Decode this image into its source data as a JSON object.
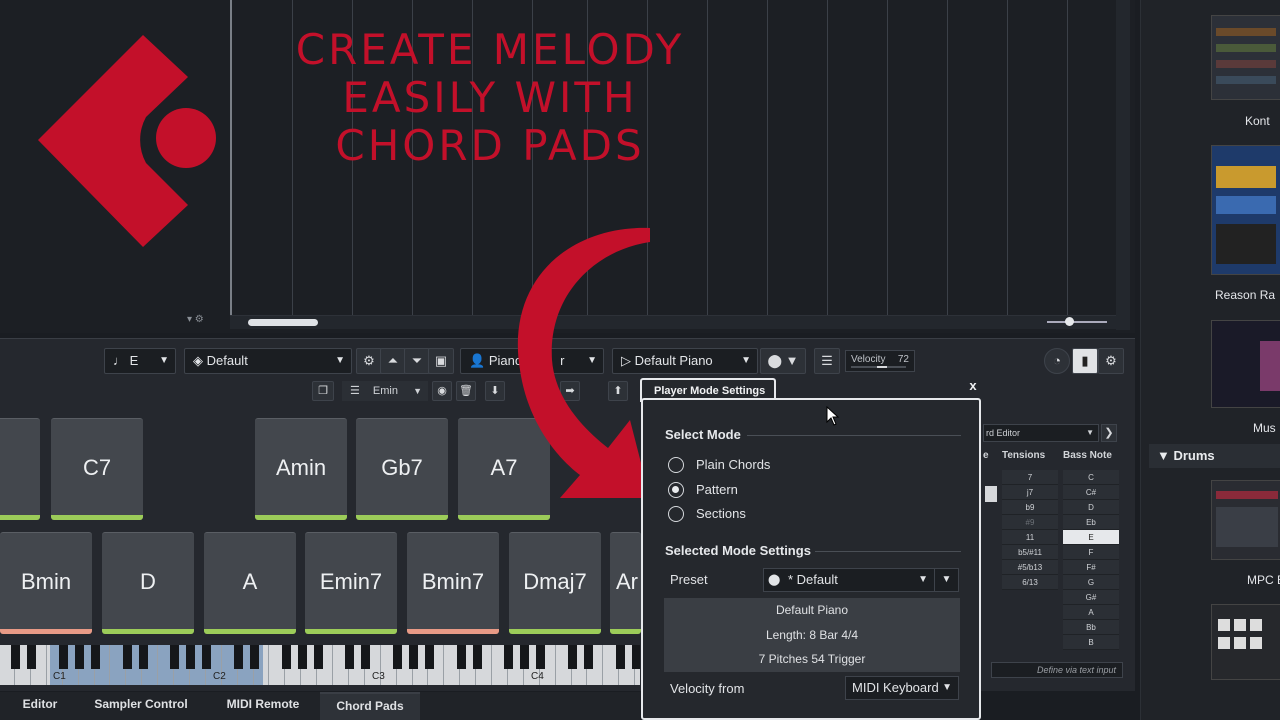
{
  "overlay": {
    "title_lines": [
      "CREATE MELODY",
      "EASILY WITH",
      "CHORD PADS"
    ],
    "accent_color": "#c3102a"
  },
  "media_panel": {
    "items": [
      {
        "label": "Kont"
      },
      {
        "label": "Reason Ra"
      },
      {
        "label": "Mus"
      },
      {
        "label": "MPC E"
      }
    ],
    "drums_header": "Drums"
  },
  "toolbar": {
    "key": "E",
    "track_preset": "Default",
    "instrument": "Piano",
    "instrument_suffix": "r",
    "player": "Default Piano",
    "velocity_label": "Velocity",
    "velocity_value": "72",
    "chord_select": "Emin"
  },
  "pads": {
    "row1": [
      "C7",
      "Amin",
      "Gb7",
      "A7"
    ],
    "row2": [
      "Bmin",
      "D",
      "A",
      "Emin7",
      "Bmin7",
      "Dmaj7",
      "Ar"
    ]
  },
  "keyboard": {
    "labels": [
      "C1",
      "C2",
      "C3",
      "C4"
    ]
  },
  "tabs": [
    "Editor",
    "Sampler Control",
    "MIDI Remote",
    "Chord Pads"
  ],
  "chord_editor": {
    "dropdown": "rd Editor",
    "col_partial": "e",
    "col_tensions": "Tensions",
    "col_bass": "Bass Note",
    "tensions": [
      "7",
      "j7",
      "b9",
      "#9",
      "11",
      "b5/#11",
      "#5/b13",
      "6/13"
    ],
    "bass_notes": [
      "C",
      "C#",
      "D",
      "Eb",
      "E",
      "F",
      "F#",
      "G",
      "G#",
      "A",
      "Bb",
      "B"
    ],
    "define_hint": "Define via text input"
  },
  "dialog": {
    "title": "Player Mode Settings",
    "close": "x",
    "select_mode_header": "Select Mode",
    "modes": [
      "Plain Chords",
      "Pattern",
      "Sections"
    ],
    "selected_mode": "Pattern",
    "settings_header": "Selected Mode Settings",
    "preset_label": "Preset",
    "preset_value": "* Default",
    "info": {
      "name": "Default Piano",
      "length": "Length: 8  Bar 4/4",
      "pitches": "7 Pitches 54 Trigger"
    },
    "velocity_from_label": "Velocity from",
    "velocity_from_value": "MIDI Keyboard"
  }
}
